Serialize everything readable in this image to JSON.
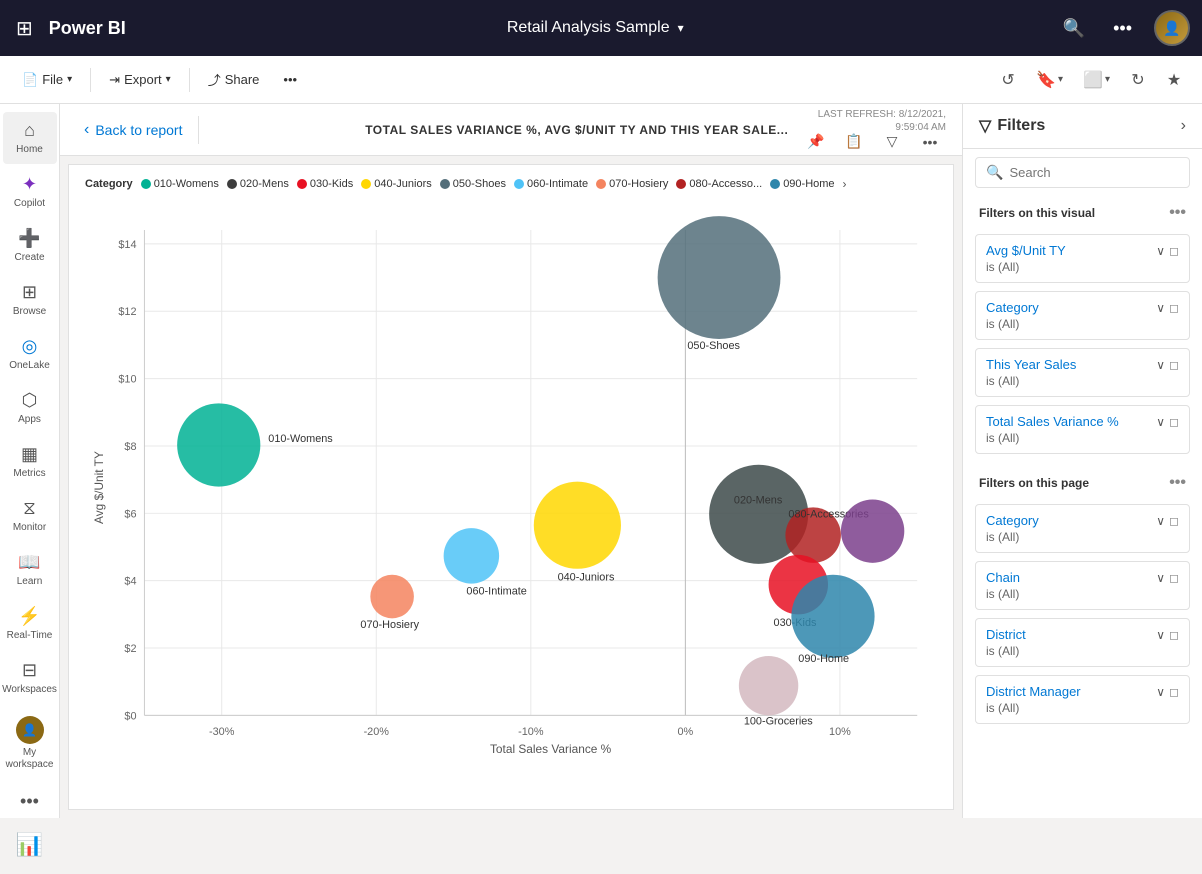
{
  "app": {
    "name": "Power BI",
    "title": "Retail Analysis Sample",
    "title_chevron": "▾"
  },
  "toolbar": {
    "file_label": "File",
    "export_label": "Export",
    "share_label": "Share",
    "more_icon": "•••"
  },
  "sidebar": {
    "items": [
      {
        "id": "home",
        "label": "Home",
        "icon": "⌂"
      },
      {
        "id": "copilot",
        "label": "Copilot",
        "icon": "✦"
      },
      {
        "id": "create",
        "label": "Create",
        "icon": "+"
      },
      {
        "id": "browse",
        "label": "Browse",
        "icon": "⊞"
      },
      {
        "id": "onelake",
        "label": "OneLake",
        "icon": "◎"
      },
      {
        "id": "apps",
        "label": "Apps",
        "icon": "⬡"
      },
      {
        "id": "metrics",
        "label": "Metrics",
        "icon": "▦"
      },
      {
        "id": "monitor",
        "label": "Monitor",
        "icon": "⧖"
      },
      {
        "id": "learn",
        "label": "Learn",
        "icon": "🎓"
      },
      {
        "id": "realtime",
        "label": "Real-Time",
        "icon": "⚡"
      },
      {
        "id": "workspaces",
        "label": "Workspaces",
        "icon": "⊟"
      }
    ],
    "bottom": {
      "workspace_label": "My workspace",
      "more_label": "..."
    }
  },
  "focus_view": {
    "back_label": "Back to report",
    "chart_title": "TOTAL SALES VARIANCE %, AVG $/UNIT TY AND THIS YEAR SALE...",
    "refresh_line1": "LAST REFRESH: 8/12/2021,",
    "refresh_line2": "9:59:04 AM"
  },
  "legend": {
    "label": "Category",
    "items": [
      {
        "id": "010-Womens",
        "label": "010-Womens",
        "color": "#00b294"
      },
      {
        "id": "020-Mens",
        "label": "020-Mens",
        "color": "#3d3d3d"
      },
      {
        "id": "030-Kids",
        "label": "030-Kids",
        "color": "#e81123"
      },
      {
        "id": "040-Juniors",
        "label": "040-Juniors",
        "color": "#ffd700"
      },
      {
        "id": "050-Shoes",
        "label": "050-Shoes",
        "color": "#505050"
      },
      {
        "id": "060-Intimate",
        "label": "060-Intimate",
        "color": "#00b4d8"
      },
      {
        "id": "070-Hosiery",
        "label": "070-Hosiery",
        "color": "#f4845f"
      },
      {
        "id": "080-Accesso",
        "label": "080-Accesso...",
        "color": "#b22222"
      },
      {
        "id": "090-Home",
        "label": "090-Home",
        "color": "#2e86ab"
      }
    ]
  },
  "chart": {
    "x_title": "Total Sales Variance %",
    "y_title": "Avg $/Unit TY",
    "x_ticks": [
      "-30%",
      "-20%",
      "-10%",
      "0%",
      "10%"
    ],
    "y_ticks": [
      "$0",
      "$2",
      "$4",
      "$6",
      "$8",
      "$10",
      "$12",
      "$14"
    ],
    "bubbles": [
      {
        "id": "010-Womens",
        "label": "010-Womens",
        "x": -28,
        "y": 7.8,
        "r": 42,
        "color": "#00b294"
      },
      {
        "id": "020-Mens",
        "label": "020-Mens",
        "x": 2,
        "y": 5.8,
        "r": 50,
        "color": "#3d4a4a"
      },
      {
        "id": "030-Kids",
        "label": "030-Kids",
        "x": 3.5,
        "y": 4.2,
        "r": 30,
        "color": "#e81123"
      },
      {
        "id": "040-Juniors",
        "label": "040-Juniors",
        "x": -7,
        "y": 5.5,
        "r": 44,
        "color": "#ffd700"
      },
      {
        "id": "050-Shoes",
        "label": "050-Shoes",
        "x": 0,
        "y": 13.5,
        "r": 62,
        "color": "#546e7a"
      },
      {
        "id": "060-Intimate",
        "label": "060-Intimate",
        "x": -15,
        "y": 4.6,
        "r": 28,
        "color": "#4fc3f7"
      },
      {
        "id": "070-Hosiery",
        "label": "070-Hosiery",
        "x": -19,
        "y": 3.8,
        "r": 22,
        "color": "#f4845f"
      },
      {
        "id": "080-Accessories",
        "label": "080-Accessories",
        "x": 5,
        "y": 5.2,
        "r": 28,
        "color": "#b22222"
      },
      {
        "id": "090-Home",
        "label": "090-Home",
        "x": 6,
        "y": 4.4,
        "r": 42,
        "color": "#2e86ab"
      },
      {
        "id": "100-Groceries",
        "label": "100-Groceries",
        "x": 4.5,
        "y": 0.8,
        "r": 30,
        "color": "#d4b8c0"
      }
    ]
  },
  "filters": {
    "title": "Filters",
    "search_placeholder": "Search",
    "visual_section": "Filters on this visual",
    "page_section": "Filters on this page",
    "visual_items": [
      {
        "name": "Avg $/Unit TY",
        "value": "is (All)"
      },
      {
        "name": "Category",
        "value": "is (All)"
      },
      {
        "name": "This Year Sales",
        "value": "is (All)"
      },
      {
        "name": "Total Sales Variance %",
        "value": "is (All)"
      }
    ],
    "page_items": [
      {
        "name": "Category",
        "value": "is (All)"
      },
      {
        "name": "Chain",
        "value": "is (All)"
      },
      {
        "name": "District",
        "value": "is (All)"
      },
      {
        "name": "District Manager",
        "value": "is (All)"
      }
    ]
  }
}
